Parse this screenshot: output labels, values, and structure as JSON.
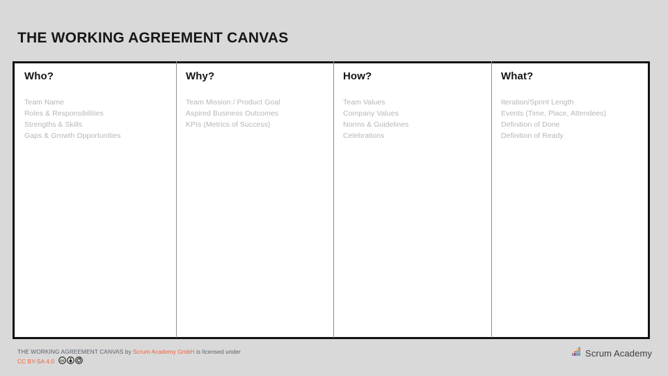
{
  "slide": {
    "title": "THE WORKING AGREEMENT CANVAS",
    "background_color": "#d9d9d9"
  },
  "canvas": {
    "border_color": "#121212",
    "divider_color": "#8d8d8d",
    "item_color": "#b6b6b6",
    "columns": [
      {
        "heading": "Who?",
        "items": [
          "Team Name",
          "Roles & Responsibilities",
          "Strengths & Skills",
          "Gaps & Growth Opportunities"
        ]
      },
      {
        "heading": "Why?",
        "items": [
          "Team Mission / Product Goal",
          "Aspired Business Outcomes",
          "KPIs (Metrics of Success)"
        ]
      },
      {
        "heading": "How?",
        "items": [
          "Team Values",
          "Company Values",
          "Norms & Guidelines",
          "Celebrations"
        ]
      },
      {
        "heading": "What?",
        "items": [
          "Iteration/Sprint Length",
          "Events (Time, Place, Attendees)",
          "Definition of Done",
          "Definition of Ready"
        ]
      }
    ]
  },
  "footer": {
    "work_title": "THE WORKING AGREEMENT CANVAS",
    "by_word": "by",
    "author": "Scrum Academy GmbH",
    "licensed_text": "is licensed under",
    "license": "CC BY-SA 4.0",
    "link_color": "#f0603a",
    "text_color": "#58616b",
    "badges": [
      "cc-logo-icon",
      "cc-by-person-icon",
      "cc-sharealike-icon"
    ]
  },
  "brand": {
    "name": "Scrum Academy",
    "mark_colors": [
      "#8b8f94",
      "#f0603a",
      "#e8b63c",
      "#8e4f9e",
      "#4a9fd8"
    ]
  }
}
